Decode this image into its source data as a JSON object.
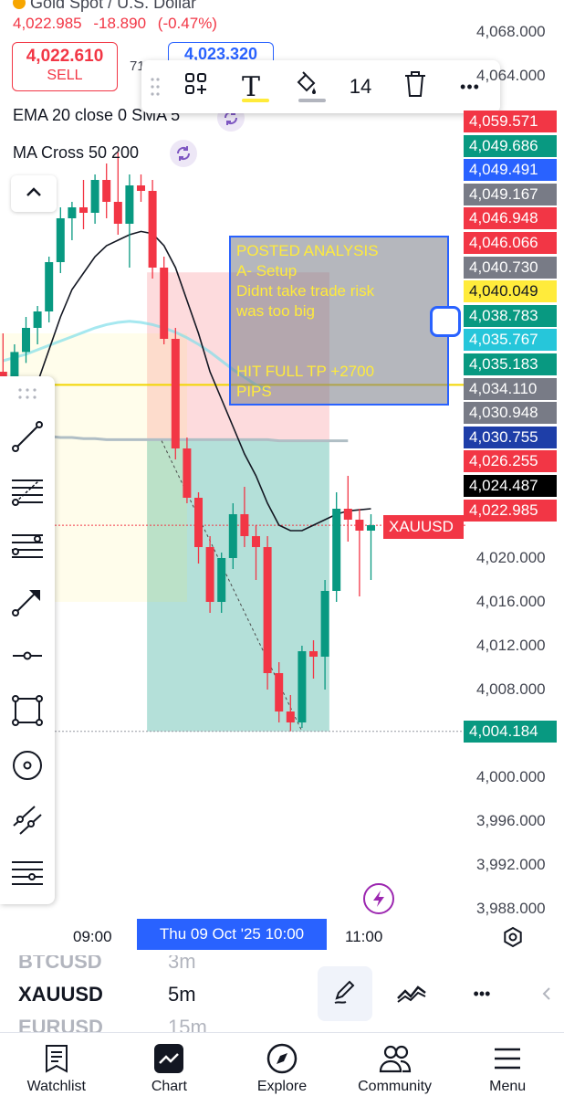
{
  "header": {
    "symbol_title": "Gold Spot / U.S. Dollar",
    "last_price": "4,022.985",
    "change": "-18.890",
    "change_pct": "(-0.47%)",
    "sell_price": "4,022.610",
    "sell_label": "SELL",
    "buy_price": "4,023.320",
    "spread": "71"
  },
  "draw_toolbar": {
    "size_value": "14",
    "text_tool_glyph": "T",
    "more_glyph": "•••"
  },
  "indicators": {
    "ema_label": "EMA 20 close 0 SMA 5",
    "ma_cross_label": "MA Cross 50 200"
  },
  "analysis_note": {
    "text": "POSTED ANALYSIS\nA- Setup\nDidnt take trade risk\nwas too big\n\n\nHIT FULL TP +2700\nPIPS"
  },
  "price_axis": {
    "ticks": [
      {
        "label": "4,068.000",
        "price": 4068
      },
      {
        "label": "4,064.000",
        "price": 4064
      },
      {
        "label": "4,020.000",
        "price": 4020
      },
      {
        "label": "4,016.000",
        "price": 4016
      },
      {
        "label": "4,012.000",
        "price": 4012
      },
      {
        "label": "4,008.000",
        "price": 4008
      },
      {
        "label": "4,000.000",
        "price": 4000
      },
      {
        "label": "3,996.000",
        "price": 3996
      },
      {
        "label": "3,992.000",
        "price": 3992
      },
      {
        "label": "3,988.000",
        "price": 3988
      }
    ],
    "badges": [
      {
        "label": "4,059.571",
        "color": "#f23645"
      },
      {
        "label": "4,049.686",
        "color": "#089981"
      },
      {
        "label": "4,049.491",
        "color": "#2962ff"
      },
      {
        "label": "4,049.167",
        "color": "#787b86"
      },
      {
        "label": "4,046.948",
        "color": "#f23645"
      },
      {
        "label": "4,046.066",
        "color": "#f23645"
      },
      {
        "label": "4,040.730",
        "color": "#787b86"
      },
      {
        "label": "4,040.049",
        "color": "#ffeb3b"
      },
      {
        "label": "4,038.783",
        "color": "#089981"
      },
      {
        "label": "4,035.767",
        "color": "#26c6da"
      },
      {
        "label": "4,035.183",
        "color": "#089981"
      },
      {
        "label": "4,034.110",
        "color": "#787b86"
      },
      {
        "label": "4,030.948",
        "color": "#787b86"
      },
      {
        "label": "4,030.755",
        "color": "#1e3ea8"
      },
      {
        "label": "4,026.255",
        "color": "#f23645"
      },
      {
        "label": "4,024.487",
        "color": "#000000"
      },
      {
        "label": "4,022.985",
        "color": "#f23645"
      }
    ],
    "target_badge": {
      "label": "4,004.184",
      "color": "#089981"
    },
    "symbol_tag": "XAUUSD"
  },
  "time_axis": {
    "left_label": "09:00",
    "cursor_label": "Thu 09 Oct '25  10:00",
    "right_label": "11:00"
  },
  "picker": {
    "prev_symbol": "BTCUSD",
    "prev_interval": "3m",
    "symbol": "XAUUSD",
    "interval": "5m",
    "next_symbol": "EURUSD",
    "next_interval": "15m",
    "more_glyph": "•••"
  },
  "bottom_nav": [
    {
      "label": "Watchlist",
      "icon": "watchlist-icon"
    },
    {
      "label": "Chart",
      "icon": "chart-icon"
    },
    {
      "label": "Explore",
      "icon": "compass-icon"
    },
    {
      "label": "Community",
      "icon": "community-icon"
    },
    {
      "label": "Menu",
      "icon": "menu-icon"
    }
  ],
  "colors": {
    "up": "#089981",
    "down": "#f23645",
    "accent": "#2962ff",
    "note_text": "#ffeb3b"
  },
  "chart_data": {
    "type": "candlestick",
    "series": [
      {
        "time": "08:15",
        "open": 4037.0,
        "high": 4040.5,
        "low": 4034.0,
        "close": 4035.5
      },
      {
        "time": "08:20",
        "open": 4035.5,
        "high": 4039.5,
        "low": 4034.5,
        "close": 4038.8
      },
      {
        "time": "08:25",
        "open": 4038.8,
        "high": 4042.0,
        "low": 4037.8,
        "close": 4041.0
      },
      {
        "time": "08:30",
        "open": 4041.0,
        "high": 4043.0,
        "low": 4039.5,
        "close": 4042.5
      },
      {
        "time": "08:35",
        "open": 4042.5,
        "high": 4047.5,
        "low": 4041.5,
        "close": 4047.0
      },
      {
        "time": "08:40",
        "open": 4047.0,
        "high": 4052.0,
        "low": 4046.0,
        "close": 4051.0
      },
      {
        "time": "08:45",
        "open": 4051.0,
        "high": 4052.5,
        "low": 4049.0,
        "close": 4052.0
      },
      {
        "time": "08:50",
        "open": 4052.0,
        "high": 4054.5,
        "low": 4050.0,
        "close": 4051.5
      },
      {
        "time": "08:55",
        "open": 4051.5,
        "high": 4055.0,
        "low": 4050.5,
        "close": 4054.5
      },
      {
        "time": "09:00",
        "open": 4054.5,
        "high": 4056.0,
        "low": 4051.0,
        "close": 4052.5
      },
      {
        "time": "09:05",
        "open": 4052.5,
        "high": 4057.0,
        "low": 4049.5,
        "close": 4050.5
      },
      {
        "time": "09:10",
        "open": 4050.5,
        "high": 4055.0,
        "low": 4046.5,
        "close": 4054.0
      },
      {
        "time": "09:15",
        "open": 4054.0,
        "high": 4055.0,
        "low": 4052.5,
        "close": 4053.5
      },
      {
        "time": "09:20",
        "open": 4053.5,
        "high": 4054.5,
        "low": 4045.5,
        "close": 4046.5
      },
      {
        "time": "09:25",
        "open": 4046.5,
        "high": 4047.5,
        "low": 4039.5,
        "close": 4040.0
      },
      {
        "time": "09:30",
        "open": 4040.0,
        "high": 4041.0,
        "low": 4029.0,
        "close": 4030.0
      },
      {
        "time": "09:35",
        "open": 4030.0,
        "high": 4031.0,
        "low": 4025.0,
        "close": 4025.5
      },
      {
        "time": "09:40",
        "open": 4025.5,
        "high": 4026.0,
        "low": 4019.5,
        "close": 4021.0
      },
      {
        "time": "09:45",
        "open": 4021.0,
        "high": 4022.0,
        "low": 4015.0,
        "close": 4016.0
      },
      {
        "time": "09:50",
        "open": 4016.0,
        "high": 4020.5,
        "low": 4015.0,
        "close": 4020.0
      },
      {
        "time": "09:55",
        "open": 4020.0,
        "high": 4025.0,
        "low": 4019.0,
        "close": 4024.0
      },
      {
        "time": "10:00",
        "open": 4024.0,
        "high": 4026.5,
        "low": 4021.0,
        "close": 4022.0
      },
      {
        "time": "10:05",
        "open": 4022.0,
        "high": 4023.0,
        "low": 4018.0,
        "close": 4021.0
      },
      {
        "time": "10:10",
        "open": 4021.0,
        "high": 4022.0,
        "low": 4008.0,
        "close": 4009.5
      },
      {
        "time": "10:15",
        "open": 4009.5,
        "high": 4010.5,
        "low": 4005.0,
        "close": 4006.0
      },
      {
        "time": "10:20",
        "open": 4006.0,
        "high": 4007.5,
        "low": 4004.2,
        "close": 4005.0
      },
      {
        "time": "10:25",
        "open": 4005.0,
        "high": 4012.0,
        "low": 4004.5,
        "close": 4011.5
      },
      {
        "time": "10:30",
        "open": 4011.5,
        "high": 4012.5,
        "low": 4009.0,
        "close": 4011.0
      },
      {
        "time": "10:35",
        "open": 4011.0,
        "high": 4018.0,
        "low": 4008.0,
        "close": 4017.0
      },
      {
        "time": "10:40",
        "open": 4017.0,
        "high": 4026.0,
        "low": 4016.0,
        "close": 4024.5
      },
      {
        "time": "10:45",
        "open": 4024.5,
        "high": 4027.5,
        "low": 4021.5,
        "close": 4023.5
      },
      {
        "time": "10:50",
        "open": 4023.5,
        "high": 4024.5,
        "low": 4016.5,
        "close": 4022.5
      },
      {
        "time": "10:55",
        "open": 4022.5,
        "high": 4024.0,
        "low": 4018.0,
        "close": 4023.0
      }
    ],
    "ema": [
      4031,
      4032,
      4034,
      4036,
      4039,
      4042,
      4044.5,
      4046,
      4047.5,
      4048.5,
      4049,
      4049.5,
      4049.8,
      4049.6,
      4048.5,
      4046.5,
      4043.5,
      4040.5,
      4037,
      4034.5,
      4032,
      4029.5,
      4027.5,
      4025,
      4023,
      4022.5,
      4022.5,
      4023,
      4023.5,
      4024,
      4024.3,
      4024.4,
      4024.5
    ],
    "ma50": [
      4038,
      4038.3,
      4038.6,
      4039,
      4039.4,
      4039.8,
      4040.2,
      4040.6,
      4041,
      4041.3,
      4041.5,
      4041.6,
      4041.5,
      4041.3,
      4041,
      4040.6,
      4040.1,
      4039.5,
      4038.8,
      4038.0,
      4037.2,
      4036.5,
      4035.8,
      4035.3
    ],
    "ma200": [
      4031.5,
      4031.4,
      4031.3,
      4031.2,
      4031.1,
      4031.0,
      4031.0,
      4030.9,
      4030.9,
      4030.8,
      4030.8,
      4030.8,
      4030.8,
      4030.8,
      4030.8,
      4030.8,
      4030.8,
      4030.8,
      4030.8,
      4030.8,
      4030.8,
      4030.8,
      4030.8,
      4030.8,
      4030.7,
      4030.7,
      4030.7,
      4030.7,
      4030.7,
      4030.7,
      4030.7
    ],
    "horizontal_levels": {
      "yellow": 4035.8,
      "last": 4022.985,
      "target": 4004.184
    },
    "position_tool": {
      "entry": 4030.755,
      "stop": 4046.066,
      "target": 4004.184,
      "from": "09:20",
      "to": "10:25"
    }
  }
}
